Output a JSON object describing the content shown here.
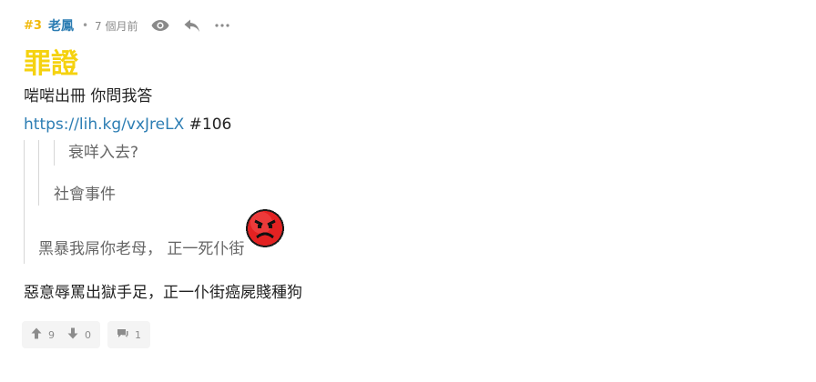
{
  "post": {
    "floor": "#3",
    "username": "老鳳",
    "separator": "•",
    "time": "7 個月前",
    "title": "罪證",
    "subtitle": "啱啱出冊 你問我答",
    "link": {
      "url": "https://lih.kg/vxJreLX",
      "suffix": "#106"
    },
    "quote": {
      "innermost": "衰咩入去?",
      "middle": "社會事件",
      "outer": "黑暴我屌你老母， 正一死仆街"
    },
    "comment": "惡意辱罵出獄手足，正一仆街癌屍賤種狗"
  },
  "actions": {
    "upvotes": "9",
    "downvotes": "0",
    "replies": "1"
  },
  "colors": {
    "floor": "#f1b90b",
    "username": "#2c7db3",
    "title": "#f5d20f",
    "link": "#2c7db3"
  },
  "icons": {
    "view": "eye-icon",
    "reply": "reply-icon",
    "more": "more-icon",
    "upvote": "thumb-up-icon",
    "downvote": "thumb-down-icon",
    "comments": "comment-icon",
    "emoji": "angry-face-icon"
  }
}
